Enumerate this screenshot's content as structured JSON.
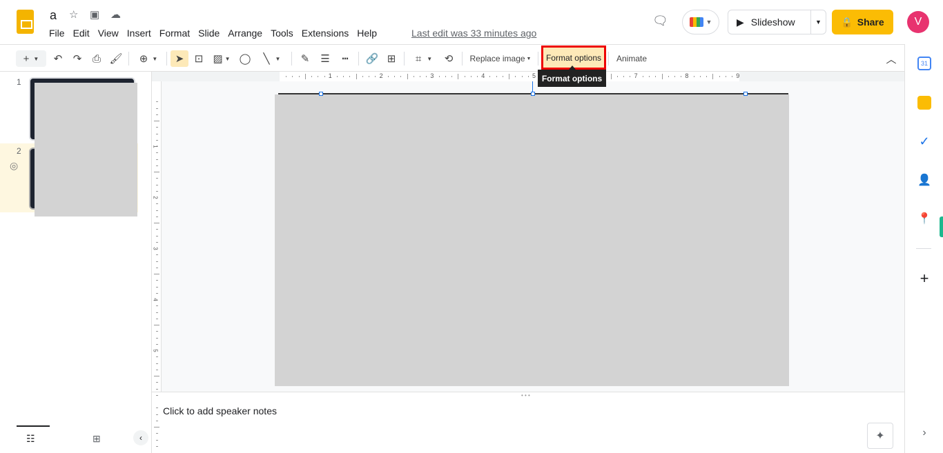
{
  "header": {
    "title": "a",
    "last_edit": "Last edit was 33 minutes ago",
    "menu": [
      "File",
      "Edit",
      "View",
      "Insert",
      "Format",
      "Slide",
      "Arrange",
      "Tools",
      "Extensions",
      "Help"
    ],
    "slideshow_label": "Slideshow",
    "share_label": "Share",
    "avatar_initial": "V"
  },
  "toolbar": {
    "replace_image": "Replace image",
    "format_options": "Format options",
    "animate": "Animate",
    "tooltip": "Format options"
  },
  "filmstrip": {
    "slides": [
      {
        "number": "1"
      },
      {
        "number": "2"
      }
    ]
  },
  "ruler": {
    "top_labels": [
      "1",
      "2",
      "3",
      "4",
      "5",
      "6",
      "7",
      "8",
      "9"
    ],
    "left_labels": [
      "1",
      "2",
      "3",
      "4",
      "5"
    ]
  },
  "notes": {
    "placeholder": "Click to add speaker notes"
  },
  "colors": {
    "accent": "#fbbc04",
    "highlight": "#fde9b8",
    "outline": "#e00000",
    "avatar": "#e8336f"
  }
}
